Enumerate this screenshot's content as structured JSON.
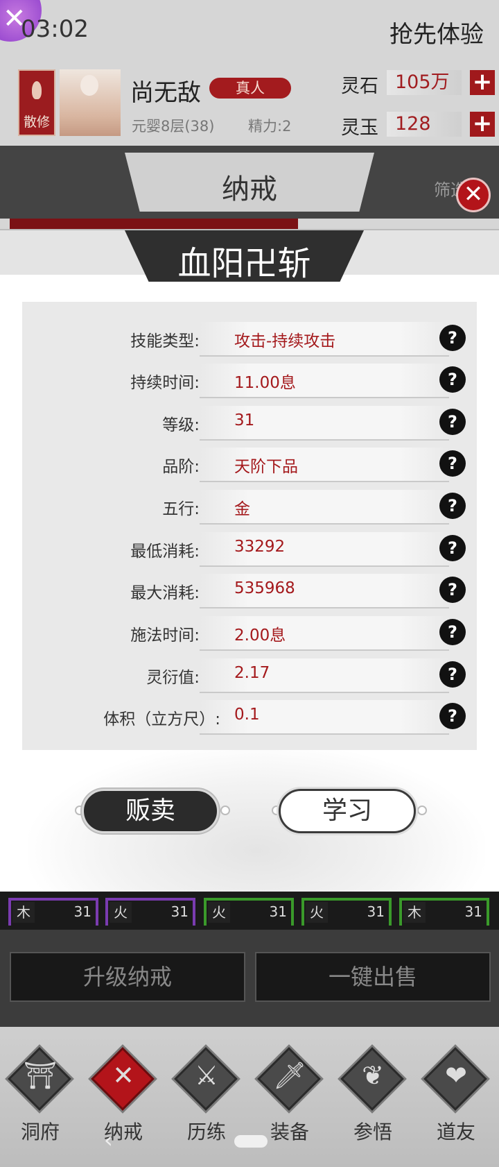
{
  "status": {
    "time": "03:02"
  },
  "header": {
    "trial_button": "抢先体验"
  },
  "player": {
    "sect": "散修",
    "name": "尚无敌",
    "rank": "真人",
    "realm": "元婴8层(38)",
    "energy": "精力:2"
  },
  "currency": {
    "spirit_stone": {
      "label": "灵石",
      "value": "105万"
    },
    "spirit_jade": {
      "label": "灵玉",
      "value": "128"
    }
  },
  "background_panel": {
    "title": "纳戒",
    "filter": "筛选"
  },
  "modal": {
    "title": "血阳卍斩",
    "attributes": [
      {
        "label": "技能类型:",
        "value": "攻击-持续攻击"
      },
      {
        "label": "持续时间:",
        "value": "11.00息"
      },
      {
        "label": "等级:",
        "value": "31"
      },
      {
        "label": "品阶:",
        "value": "天阶下品"
      },
      {
        "label": "五行:",
        "value": "金"
      },
      {
        "label": "最低消耗:",
        "value": "33292"
      },
      {
        "label": "最大消耗:",
        "value": "535968"
      },
      {
        "label": "施法时间:",
        "value": "2.00息"
      },
      {
        "label": "灵衍值:",
        "value": "2.17"
      },
      {
        "label": "体积（立方尺）:",
        "value": "0.1"
      }
    ],
    "sell_button": "贩卖",
    "learn_button": "学习"
  },
  "items": [
    {
      "element": "木",
      "level": "31",
      "border_color": "#7a3bb0"
    },
    {
      "element": "火",
      "level": "31",
      "border_color": "#7a3bb0"
    },
    {
      "element": "火",
      "level": "31",
      "border_color": "#3a9a2a"
    },
    {
      "element": "火",
      "level": "31",
      "border_color": "#3a9a2a"
    },
    {
      "element": "木",
      "level": "31",
      "border_color": "#3a9a2a"
    }
  ],
  "actions": {
    "upgrade": "升级纳戒",
    "sell_all": "一键出售"
  },
  "nav": [
    {
      "label": "洞府",
      "icon": "cave-icon"
    },
    {
      "label": "纳戒",
      "icon": "ring-icon",
      "active": true
    },
    {
      "label": "历练",
      "icon": "swords-icon"
    },
    {
      "label": "装备",
      "icon": "dagger-icon"
    },
    {
      "label": "参悟",
      "icon": "book-icon"
    },
    {
      "label": "道友",
      "icon": "handshake-icon"
    }
  ],
  "colors": {
    "accent": "#a31b1e",
    "value_text": "#a4191c"
  }
}
